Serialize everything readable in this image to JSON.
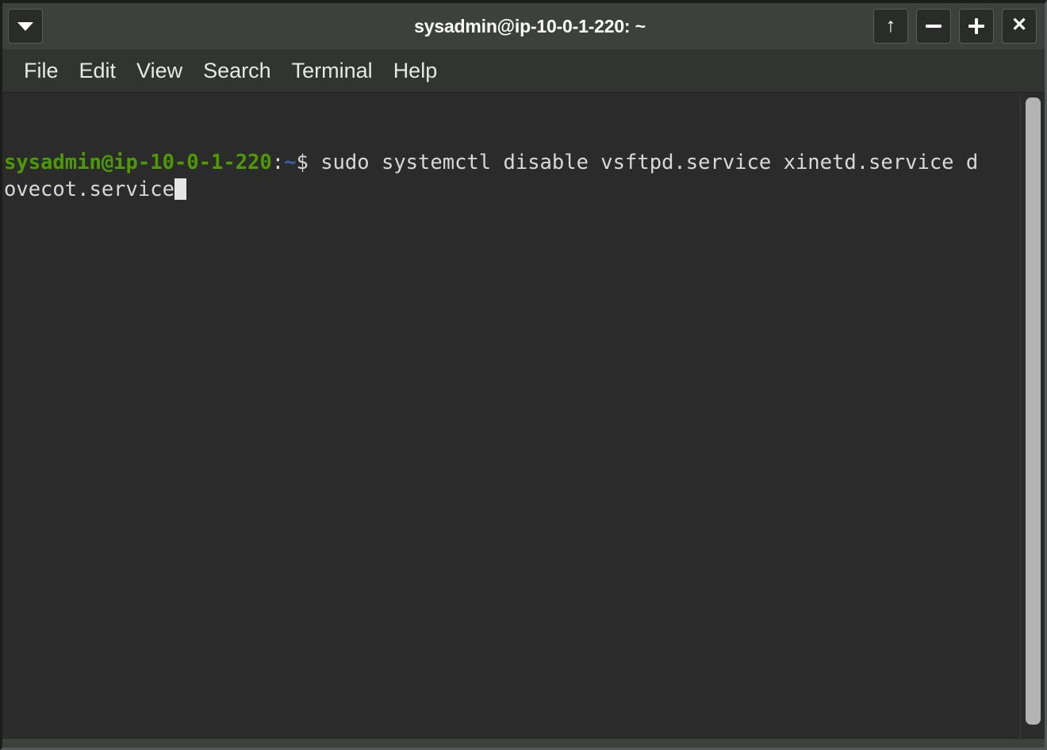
{
  "window": {
    "title": "sysadmin@ip-10-0-1-220: ~",
    "menu_button_icon": "chevron-down-icon",
    "controls": [
      {
        "name": "shade-window-button",
        "icon": "arrow-up-icon",
        "glyph": "↑"
      },
      {
        "name": "minimize-window-button",
        "icon": "minus-icon",
        "glyph": "−"
      },
      {
        "name": "maximize-window-button",
        "icon": "plus-icon",
        "glyph": "+"
      },
      {
        "name": "close-window-button",
        "icon": "close-icon",
        "glyph": "✕"
      }
    ]
  },
  "menubar": {
    "items": [
      {
        "label": "File"
      },
      {
        "label": "Edit"
      },
      {
        "label": "View"
      },
      {
        "label": "Search"
      },
      {
        "label": "Terminal"
      },
      {
        "label": "Help"
      }
    ]
  },
  "terminal": {
    "prompt": {
      "user_host": "sysadmin@ip-10-0-1-220",
      "colon": ":",
      "path": "~",
      "sigil": "$ "
    },
    "command_line_1": "sudo systemctl disable vsftpd.service xinetd.service d",
    "command_line_2": "ovecot.service",
    "full_command": "sudo systemctl disable vsftpd.service xinetd.service dovecot.service",
    "cursor": "block",
    "colors": {
      "background": "#2b2b2b",
      "foreground": "#d8d8d8",
      "prompt_green": "#4e9a06",
      "path_blue": "#3465a4",
      "cursor": "#e6e6e6"
    }
  },
  "scrollbar": {
    "name": "terminal-scrollbar",
    "thumb_color": "#b3b3b3"
  },
  "theme": {
    "titlebar_bg": "#3e403d",
    "menubar_bg": "#323431",
    "frame_dark": "#1c1d1b"
  }
}
